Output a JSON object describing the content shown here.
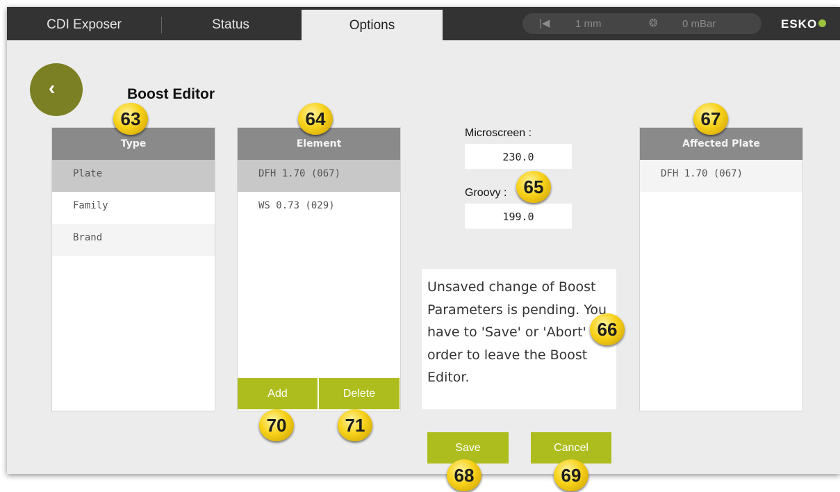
{
  "topbar": {
    "tabs": [
      {
        "label": "CDI Exposer"
      },
      {
        "label": "Status"
      },
      {
        "label": "Options"
      }
    ],
    "thickness": "1 mm",
    "pressure": "0 mBar",
    "logo_text": "ESKO"
  },
  "editor": {
    "title": "Boost Editor",
    "type_panel": {
      "header": "Type",
      "items": [
        "Plate",
        "Family",
        "Brand"
      ],
      "selected": "Plate"
    },
    "element_panel": {
      "header": "Element",
      "items": [
        "DFH 1.70 (067)",
        "WS 0.73 (029)"
      ],
      "selected": "DFH 1.70 (067)",
      "add_label": "Add",
      "delete_label": "Delete"
    },
    "microscreen": {
      "label": "Microscreen :",
      "value": "230.0"
    },
    "groovy": {
      "label": "Groovy :",
      "value": "199.0"
    },
    "message": "Unsaved change of Boost Parameters is pending. You have to 'Save' or 'Abort' in order to leave the Boost Editor.",
    "affected_panel": {
      "header": "Affected Plate",
      "items": [
        "DFH 1.70 (067)"
      ]
    },
    "save_label": "Save",
    "cancel_label": "Cancel"
  },
  "callouts": [
    "63",
    "64",
    "65",
    "66",
    "67",
    "68",
    "69",
    "70",
    "71"
  ],
  "colors": {
    "topbar": "#333333",
    "accent_button": "#adbd1e",
    "back_button": "#7c8024",
    "panel_header": "#8a8a8a",
    "callout": "#f7d21a"
  }
}
